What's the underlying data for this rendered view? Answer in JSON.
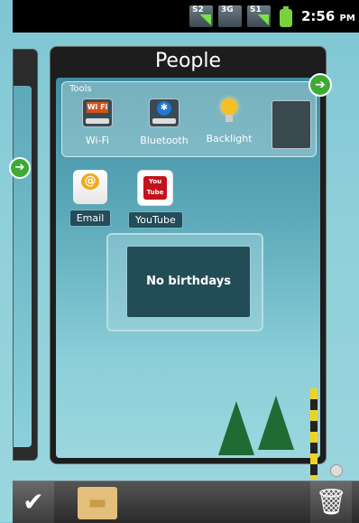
{
  "status": {
    "sim1_label": "S2",
    "sim2_label": "3G",
    "sim3_label": "S1",
    "time": "2:56",
    "ampm": "PM"
  },
  "card": {
    "title": "People",
    "tools_label": "Tools",
    "tools": [
      {
        "label": "Wi-Fi",
        "icon": "wifi-toggle-icon",
        "badge": "Wi Fi"
      },
      {
        "label": "Bluetooth",
        "icon": "bluetooth-toggle-icon",
        "badge": "✱"
      },
      {
        "label": "Backlight",
        "icon": "lightbulb-icon"
      }
    ],
    "switch_left": "0",
    "switch_right": "1",
    "apps": [
      {
        "label": "Email",
        "icon": "email-icon"
      },
      {
        "label": "YouTube",
        "icon": "youtube-icon"
      }
    ],
    "birthday_message": "No birthdays"
  },
  "dock": {
    "check_icon": "✔",
    "folder_icon": "▬",
    "trash_icon": "🗑"
  },
  "arrows": {
    "right": "➔"
  }
}
